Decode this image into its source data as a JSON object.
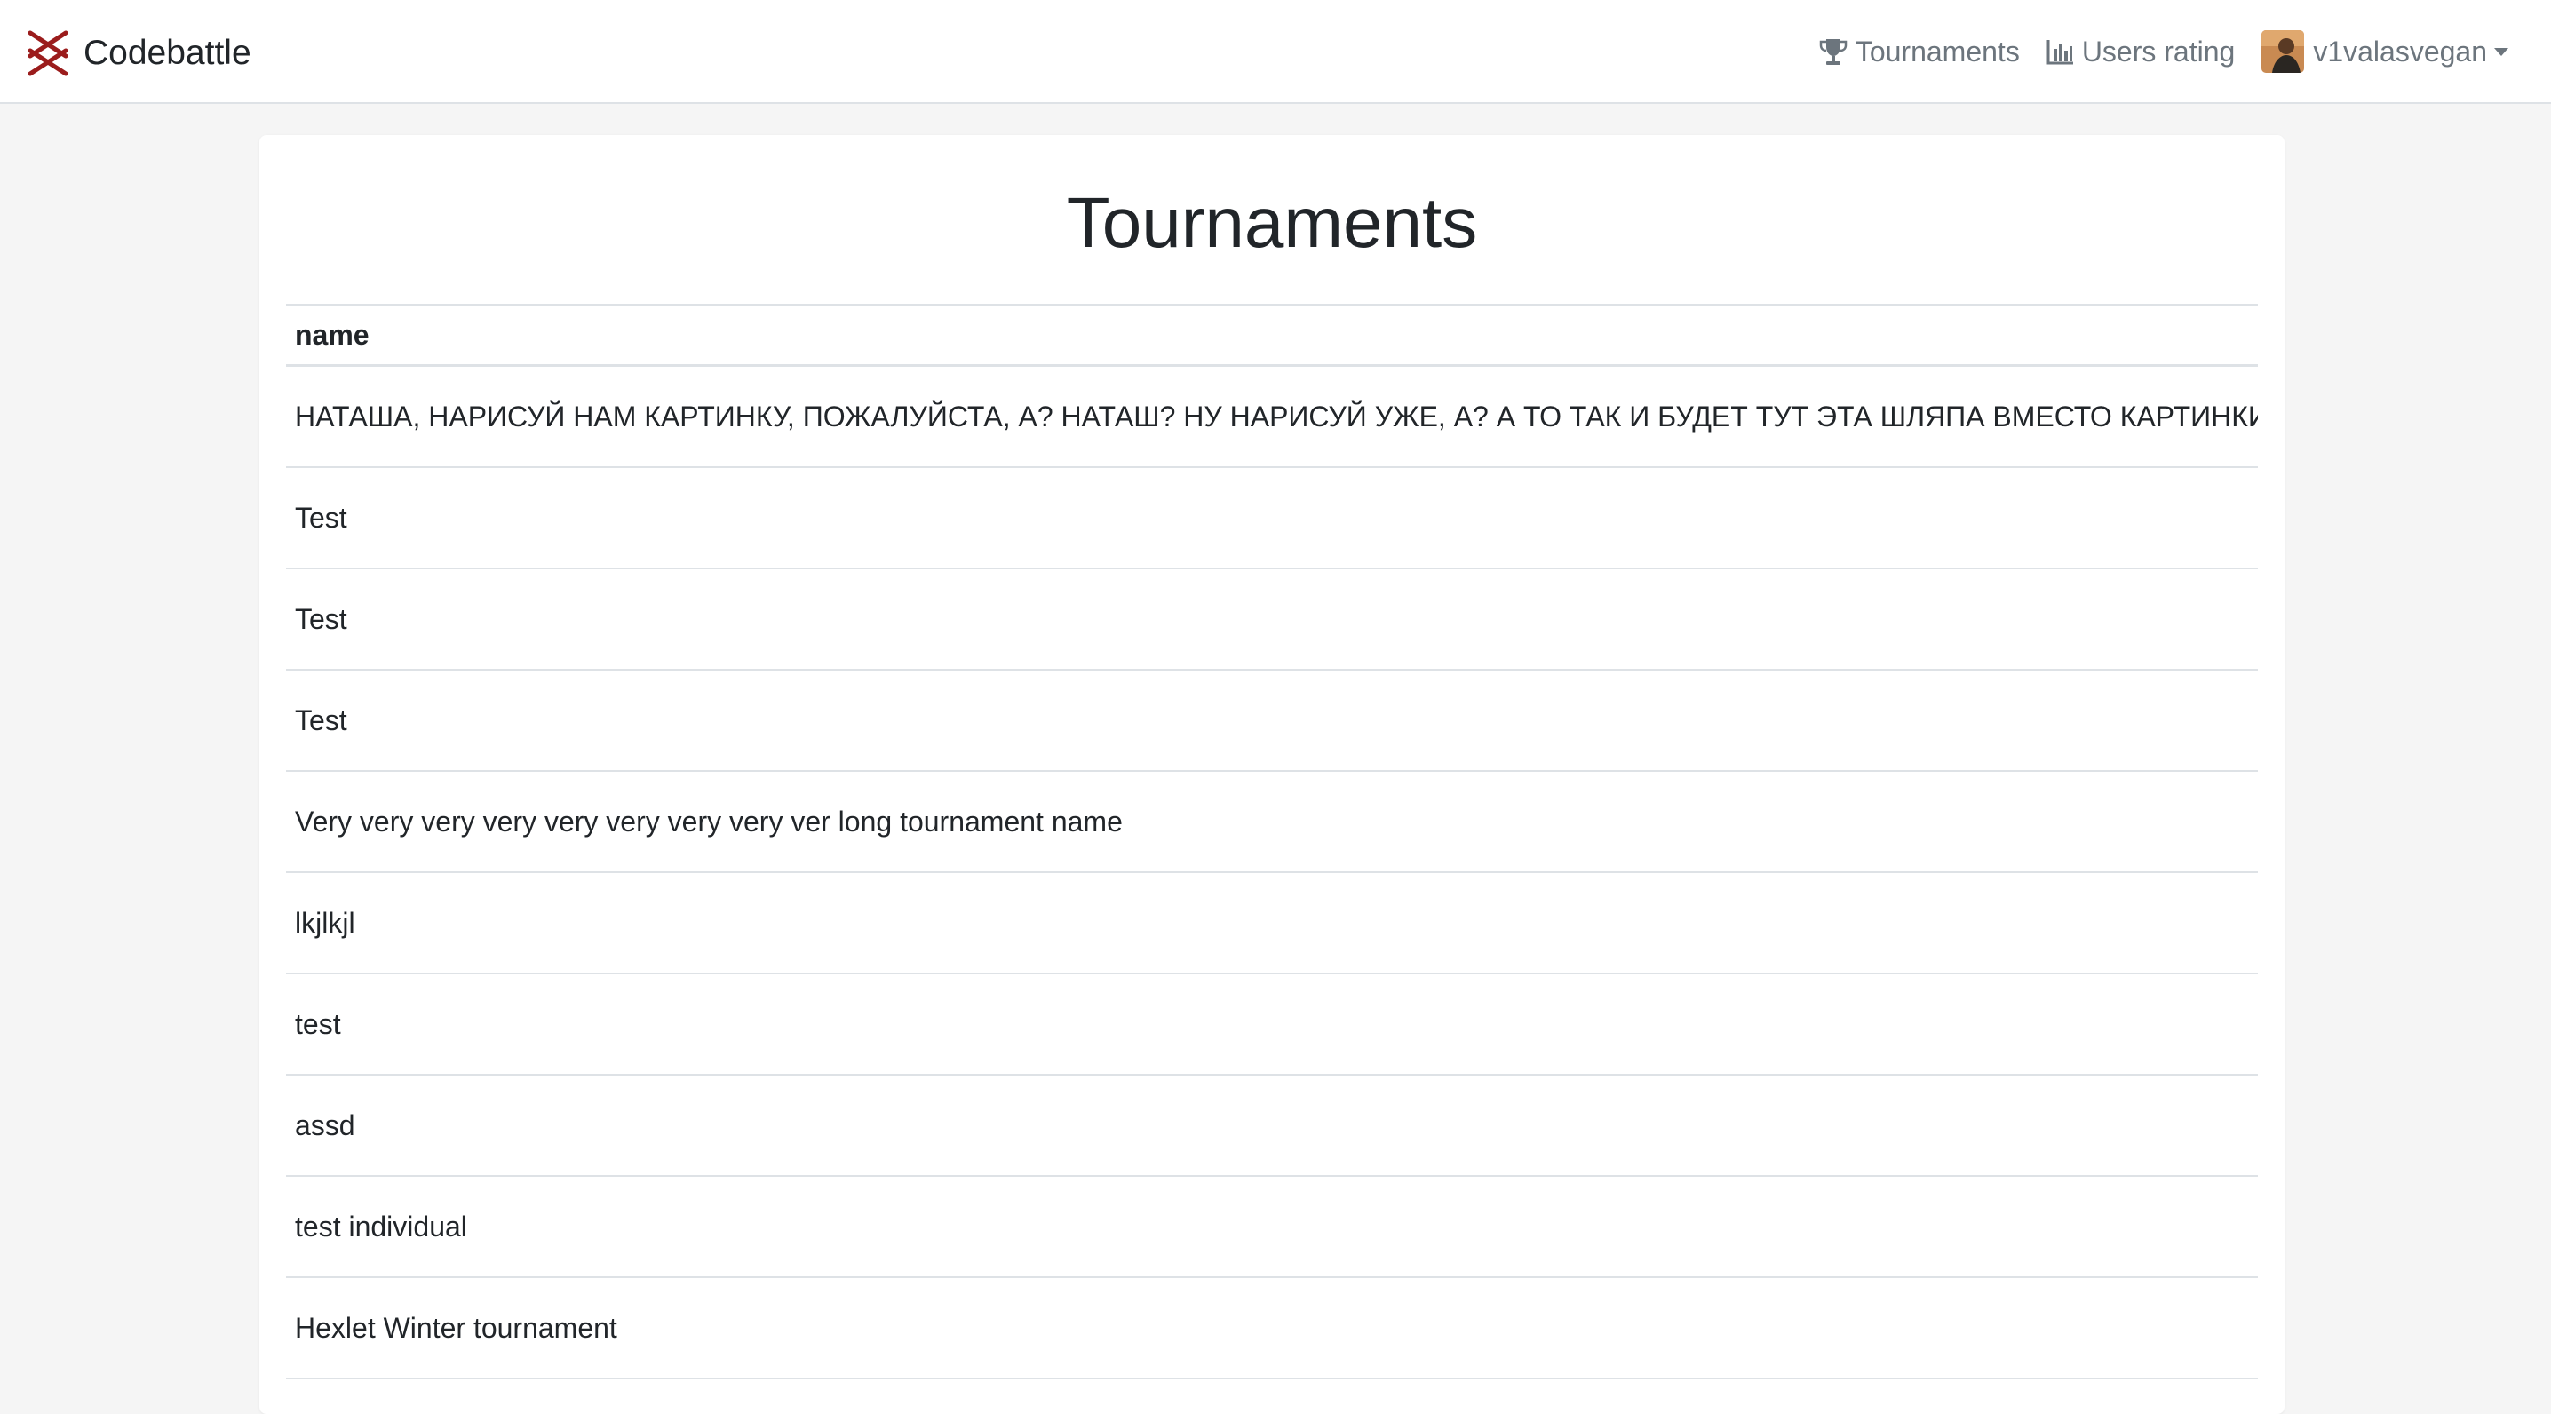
{
  "navbar": {
    "brand": "Codebattle",
    "links": {
      "tournaments": "Tournaments",
      "users_rating": "Users rating"
    },
    "user": {
      "name": "v1valasvegan"
    }
  },
  "colors": {
    "logo": "#9b1c1c",
    "nav_text": "#6c757d",
    "text": "#212529",
    "border": "#dee2e6",
    "background": "#f5f5f5"
  },
  "page": {
    "title": "Tournaments",
    "table": {
      "columns": [
        "name"
      ],
      "rows": [
        "НАТАША, НАРИСУЙ НАМ КАРТИНКУ, ПОЖАЛУЙСТА, А? НАТАШ? НУ НАРИСУЙ УЖЕ, А? А ТО ТАК И БУДЕТ ТУТ ЭТА ШЛЯПА ВМЕСТО КАРТИНКИ",
        "Test",
        "Test",
        "Test",
        "Very very very very very very very very ver long tournament name",
        "lkjlkjl",
        "test",
        "assd",
        "test individual",
        "Hexlet Winter tournament"
      ]
    }
  }
}
